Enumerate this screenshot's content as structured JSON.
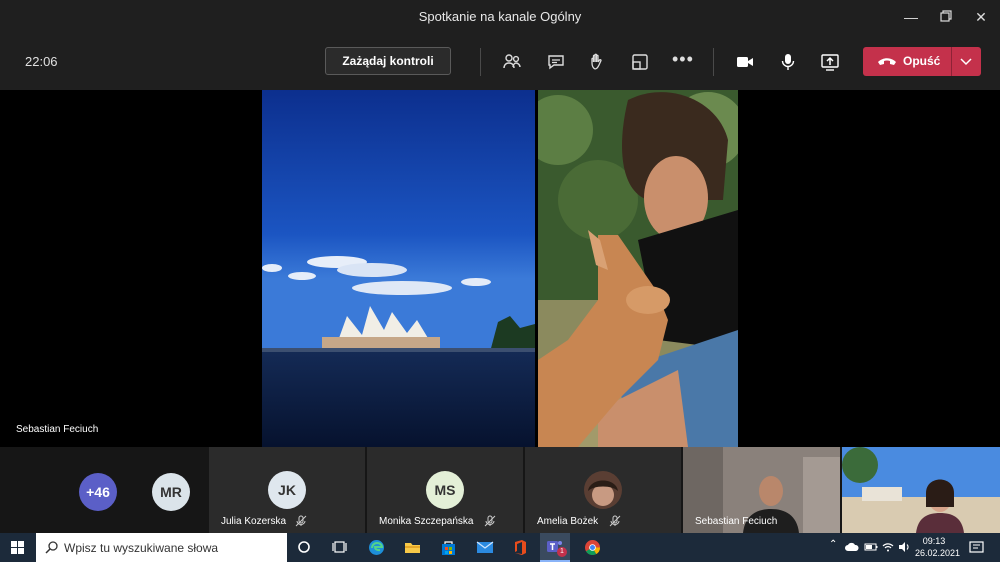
{
  "window": {
    "title": "Spotkanie na kanale Ogólny"
  },
  "toolbar": {
    "timer": "22:06",
    "control_label": "Zażądaj kontroli",
    "leave_label": "Opuść"
  },
  "main_video": {
    "speaker_name": "Sebastian Feciuch"
  },
  "participants": {
    "overflow_count": "+46",
    "initials_mr": "MR",
    "julia": {
      "initials": "JK",
      "name": "Julia Kozerska"
    },
    "monika": {
      "initials": "MS",
      "name": "Monika Szczepańska"
    },
    "amelia": {
      "name": "Amelia Bożek"
    },
    "sebastian": {
      "name": "Sebastian Feciuch"
    }
  },
  "taskbar": {
    "search_placeholder": "Wpisz tu wyszukiwane słowa",
    "time": "09:13",
    "date": "26.02.2021",
    "teams_badge": "1"
  },
  "colors": {
    "leave": "#c4314b",
    "overflow_avatar": "#5b5fc7",
    "taskbar": "#1c2a3a"
  }
}
